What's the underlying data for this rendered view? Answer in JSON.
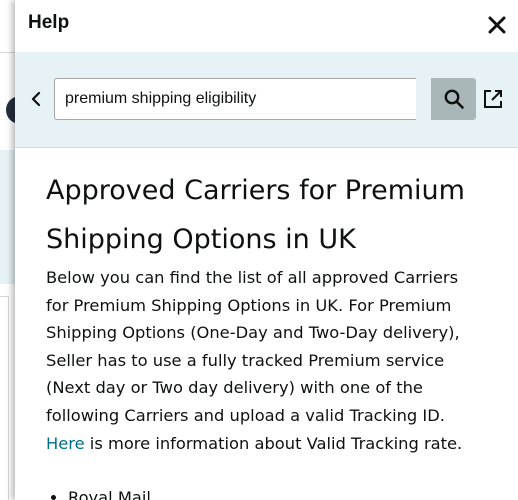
{
  "help_panel": {
    "title": "Help",
    "search": {
      "value": "premium shipping eligibility"
    }
  },
  "article": {
    "title": "Approved Carriers for Premium Shipping Options in UK",
    "intro": "Below you can find the list of all approved Carriers for Premium Shipping Options in UK. For Premium Shipping Options (One-Day and Two-Day delivery), Seller has to use a fully tracked Premium service (Next day or Two day delivery) with one of the following Carriers and upload a valid Tracking ID.",
    "link_text": "Here",
    "link_suffix": " is more information about Valid Tracking rate.",
    "carriers": [
      "Royal Mail"
    ]
  },
  "colors": {
    "panel_bar": "#e6f2f5",
    "search_button": "#aab7b8",
    "link": "#007185",
    "text": "#0f1111"
  },
  "icons": {
    "close": "close-icon",
    "back": "chevron-left-icon",
    "search": "search-icon",
    "external": "open-in-new-icon"
  }
}
